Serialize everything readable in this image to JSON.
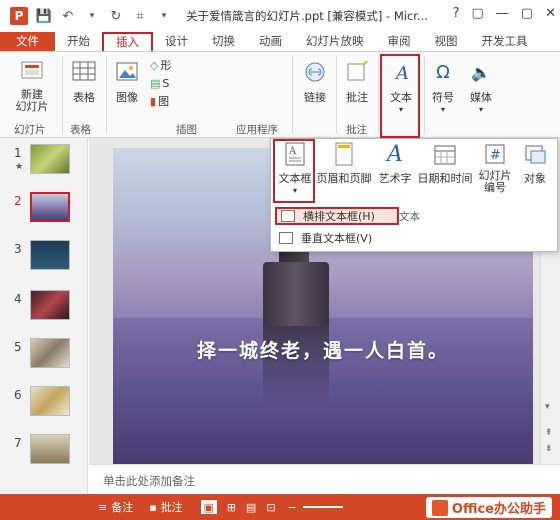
{
  "window": {
    "logo": "P",
    "title": "关于爱情箴言的幻灯片.ppt [兼容模式] - Micr...",
    "controls": [
      "?",
      "▢",
      "—",
      "▢",
      "✕"
    ]
  },
  "tabs": [
    "文件",
    "开始",
    "插入",
    "设计",
    "切换",
    "动画",
    "幻灯片放映",
    "审阅",
    "视图",
    "开发工具"
  ],
  "ribbon": {
    "new_slide": "新建\n幻灯片",
    "table": "表格",
    "image": "图像",
    "shapes_partial": [
      "形",
      "S",
      "图"
    ],
    "link": "链接",
    "comment": "批注",
    "text": "文本",
    "symbol": "符号",
    "media": "媒体",
    "groups": [
      "幻灯片",
      "表格",
      "插图",
      "应用程序",
      "批注"
    ]
  },
  "dropdown": {
    "text_box": "文本框",
    "header_footer": "页眉和页脚",
    "wordart": "艺术字",
    "date_time": "日期和时间",
    "slide_number": "幻灯片\n编号",
    "object": "对象",
    "group_label": "文本",
    "menu": [
      "横排文本框(H)",
      "垂直文本框(V)"
    ]
  },
  "thumbnails": [
    {
      "num": "1",
      "star": "★"
    },
    {
      "num": "2",
      "star": ""
    },
    {
      "num": "3",
      "star": ""
    },
    {
      "num": "4",
      "star": ""
    },
    {
      "num": "5",
      "star": ""
    },
    {
      "num": "6",
      "star": ""
    },
    {
      "num": "7",
      "star": ""
    }
  ],
  "slide": {
    "text": "择一城终老，遇一人白首。"
  },
  "notes": {
    "placeholder": "单击此处添加备注"
  },
  "status": {
    "notes": "备注",
    "comments": "批注",
    "brand": "Office办公助手"
  },
  "colors": {
    "accent": "#d24726",
    "highlight": "#c0232c"
  }
}
